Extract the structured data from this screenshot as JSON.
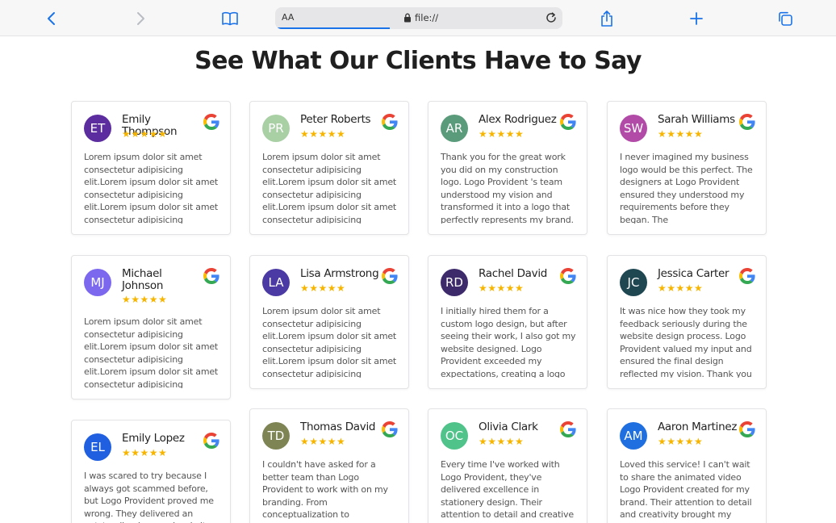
{
  "browser": {
    "text_size_label": "AA",
    "url": "file://"
  },
  "page": {
    "title": "See What Our Clients Have to Say"
  },
  "colors": {
    "star": "#f7b500",
    "link_blue": "#1a73e8"
  },
  "reviews": [
    {
      "name": "Emily Thompson",
      "initials": "ET",
      "avatar_color": "#5b2d9e",
      "rating": 5,
      "stars": "★★★★★",
      "source_icon": "google-icon",
      "text": "Lorem ipsum dolor sit amet consectetur adipisicing elit.Lorem ipsum dolor sit amet consectetur adipisicing elit.Lorem ipsum dolor sit amet consectetur adipisicing"
    },
    {
      "name": "Peter Roberts",
      "initials": "PR",
      "avatar_color": "#a9cfa4",
      "rating": 5,
      "stars": "★★★★★",
      "source_icon": "google-icon",
      "text": "Lorem ipsum dolor sit amet consectetur adipisicing elit.Lorem ipsum dolor sit amet consectetur adipisicing elit.Lorem ipsum dolor sit amet consectetur adipisicing"
    },
    {
      "name": "Alex Rodriguez",
      "initials": "AR",
      "avatar_color": "#5a9b7b",
      "rating": 5,
      "stars": "★★★★★",
      "source_icon": "google-icon",
      "text": "Thank you for the great work you did on my construction logo. Logo Provident 's team understood my vision and transformed it into a logo that perfectly represents my brand."
    },
    {
      "name": "Sarah Williams",
      "initials": "SW",
      "avatar_color": "#b24aa8",
      "rating": 5,
      "stars": "★★★★★",
      "source_icon": "google-icon",
      "text": "I never imagined my business logo would be this perfect. The designers at Logo Provident ensured they understood my requirements before they began. The"
    },
    {
      "name": "Michael Johnson",
      "initials": "MJ",
      "avatar_color": "#7b68ee",
      "rating": 5,
      "stars": "★★★★★",
      "source_icon": "google-icon",
      "text": "Lorem ipsum dolor sit amet consectetur adipisicing elit.Lorem ipsum dolor sit amet consectetur adipisicing elit.Lorem ipsum dolor sit amet consectetur adipisicing"
    },
    {
      "name": "Lisa Armstrong",
      "initials": "LA",
      "avatar_color": "#4b3aa3",
      "rating": 5,
      "stars": "★★★★★",
      "source_icon": "google-icon",
      "text": "Lorem ipsum dolor sit amet consectetur adipisicing elit.Lorem ipsum dolor sit amet consectetur adipisicing elit.Lorem ipsum dolor sit amet consectetur adipisicing"
    },
    {
      "name": "Rachel David",
      "initials": "RD",
      "avatar_color": "#3d2a6b",
      "rating": 5,
      "stars": "★★★★★",
      "source_icon": "google-icon",
      "text": "I initially hired them for a custom logo design, but after seeing their work, I also got my website designed. Logo Provident exceeded my expectations, creating a logo"
    },
    {
      "name": "Jessica Carter",
      "initials": "JC",
      "avatar_color": "#1f4752",
      "rating": 5,
      "stars": "★★★★★",
      "source_icon": "google-icon",
      "text": "It was nice how they took my feedback seriously during the website design process. Logo Provident valued my input and ensured the final design reflected my vision. Thank you"
    },
    {
      "name": "Emily Lopez",
      "initials": "EL",
      "avatar_color": "#1f5fe0",
      "rating": 5,
      "stars": "★★★★★",
      "source_icon": "google-icon",
      "text": "I was scared to try because I always got scammed before, but Logo Provident proved me wrong. They delivered an outstanding logo and website that"
    },
    {
      "name": "Thomas David",
      "initials": "TD",
      "avatar_color": "#7e8454",
      "rating": 5,
      "stars": "★★★★★",
      "source_icon": "google-icon",
      "text": "I couldn't have asked for a better team than Logo Provident to work with on my branding. From conceptualization to completion"
    },
    {
      "name": "Olivia Clark",
      "initials": "OC",
      "avatar_color": "#4fc38a",
      "rating": 5,
      "stars": "★★★★★",
      "source_icon": "google-icon",
      "text": "Every time I've worked with Logo Provident, they've delivered excellence in stationery design. Their attention to detail and creative"
    },
    {
      "name": "Aaron Martinez",
      "initials": "AM",
      "avatar_color": "#1f6fe0",
      "rating": 5,
      "stars": "★★★★★",
      "source_icon": "google-icon",
      "text": "Loved this service! I can't wait to share the animated video Logo Provident created for my brand. Their attention to detail and creativity brought my"
    }
  ]
}
